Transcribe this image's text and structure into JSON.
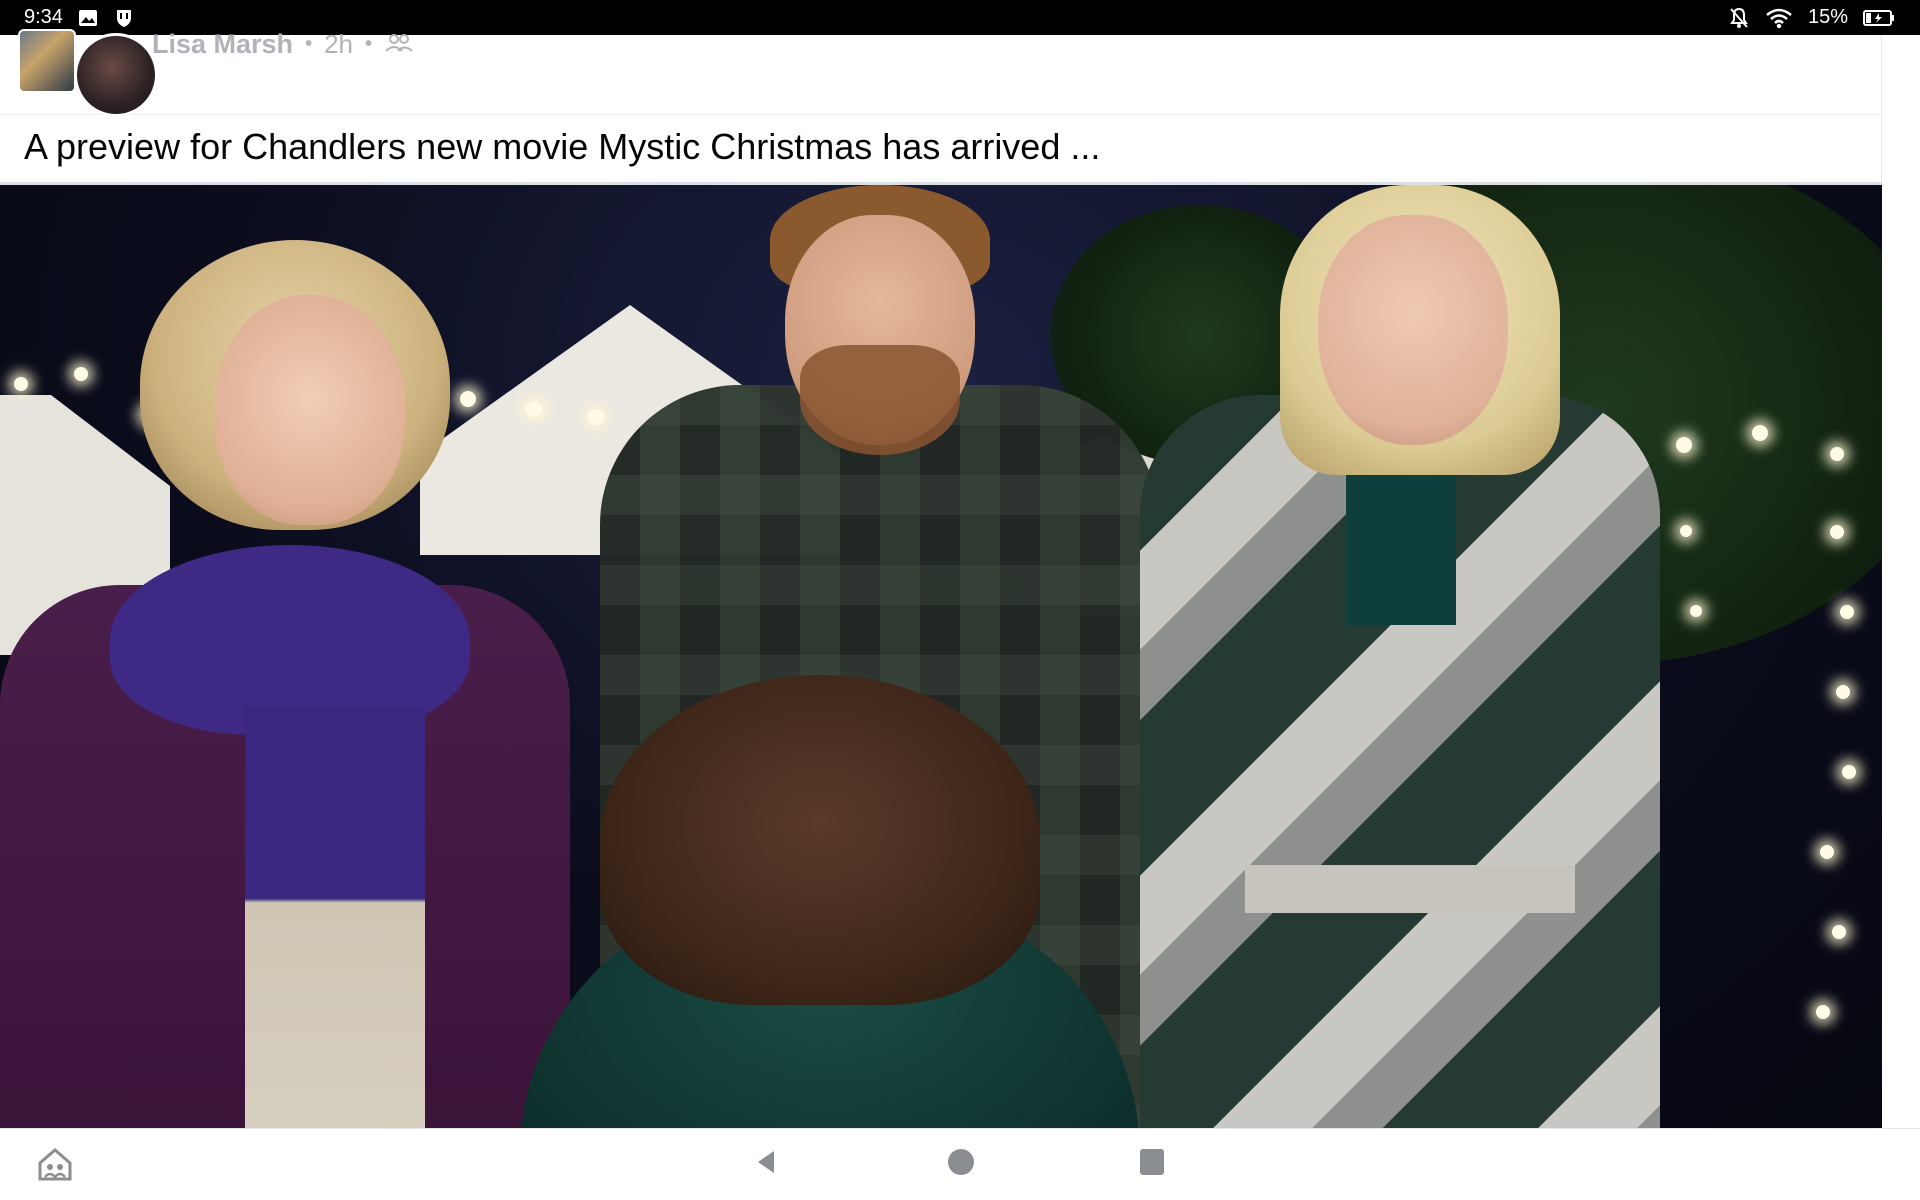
{
  "status_bar": {
    "time": "9:34",
    "battery": "15%",
    "icons": [
      "image-notification-icon",
      "shield-notification-icon",
      "dnd-off-icon",
      "wifi-icon",
      "battery-icon"
    ]
  },
  "post": {
    "author": "Lisa Marsh",
    "time": "2h",
    "audience_icon": "friends-icon",
    "text": "A preview for Chandlers new movie Mystic Christmas has arrived ..."
  },
  "nav_bar": {
    "icons": [
      "home-icon",
      "back-icon",
      "home-button-icon",
      "recents-icon"
    ]
  },
  "colors": {
    "status_bar": "#000000",
    "author_text": "#b0b3b8",
    "body_text": "#050505",
    "nav_icon": "#8a8d91"
  }
}
